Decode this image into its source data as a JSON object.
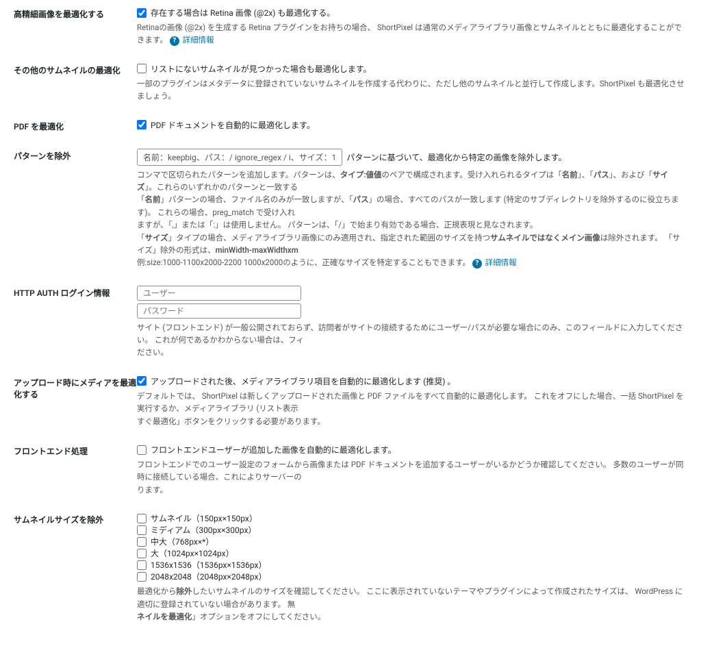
{
  "retina": {
    "label": "高精細画像を最適化する",
    "checkbox": "存在する場合は Retina 画像 (@2x) も最適化する。",
    "desc": "Retinaの画像 (@2x) を生成する Retina プラグインをお持ちの場合、 ShortPixel は通常のメディアライブラリ画像とサムネイルとともに最適化することができます。",
    "link": "詳細情報"
  },
  "other_thumbs": {
    "label": "その他のサムネイルの最適化",
    "checkbox": "リストにないサムネイルが見つかった場合も最適化します。",
    "desc": "一部のプラグインはメタデータに登録されていないサムネイルを作成する代わりに、ただし他のサムネイルと並行して作成します。ShortPixel も最適化させましょう。"
  },
  "pdf": {
    "label": "PDF を最適化",
    "checkbox": "PDF ドキュメントを自動的に最適化します。"
  },
  "exclude": {
    "label": "パターンを除外",
    "placeholder": "名前：keepbig、パス：/ ignore_regex / i、サイズ：1",
    "inline_desc": "パターンに基づいて、最適化から特定の画像を除外します。",
    "desc1a": "コンマで区切られたパターンを追加します。パターンは、",
    "desc1b": "タイプ:値値",
    "desc1c": "のペアで構成されます。受け入れられるタイプは「",
    "desc1d": "名前",
    "desc1e": "」、「",
    "desc1f": "パス",
    "desc1g": "」、および「",
    "desc1h": "サイズ",
    "desc1i": "」。これらのいずれかのパターンと一致する",
    "desc2a": "「",
    "desc2b": "名前",
    "desc2c": "」パターンの場合、ファイル名のみが一致しますが、「",
    "desc2d": "パス",
    "desc2e": "」の場合、すべてのパスが一致します (特定のサブディレクトリを除外するのに役立ちます)。 これらの場合、preg_match で受け入れ",
    "desc3": "ますが、「,」または「:」は使用しません。 パターンは、「/」で始まり有効である場合、正規表現と見なされます。",
    "desc4a": "「",
    "desc4b": "サイズ",
    "desc4c": "」タイプの場合、メディアライブラリ画像にのみ適用され、指定された範囲のサイズを持つ",
    "desc4d": "サムネイルではなくメイン画像",
    "desc4e": "は除外されます。 「サイズ」除外の形式は、",
    "desc4f": "minWidth-maxWidthxm",
    "desc5": "例:size:1000-1100x2000-2200 1000x2000のように、正確なサイズを特定することもできます。",
    "link": "詳細情報"
  },
  "http_auth": {
    "label": "HTTP AUTH ログイン情報",
    "user_placeholder": "ユーザー",
    "pass_placeholder": "パスワード",
    "desc": "サイト (フロントエンド) が一般公開されておらず、訪問者がサイトの接続するためにユーザー/パスが必要な場合にのみ、このフィールドに入力してください。 これが何であるかわからない場合は、フィ",
    "desc2": "ださい。"
  },
  "upload_opt": {
    "label": "アップロード時にメディアを最適化する",
    "checkbox": "アップロードされた後、メディアライブラリ項目を自動的に最適化します (推奨) 。",
    "desc": "デフォルトでは、 ShortPixel は新しくアップロードされた画像と PDF ファイルをすべて自動的に最適化します。 これをオフにした場合、一括 ShortPixel を実行するか、メディアライブラリ (リスト表示",
    "desc2": "すぐ最適化」ボタンをクリックする必要があります。"
  },
  "frontend": {
    "label": "フロントエンド処理",
    "checkbox": "フロントエンドユーザーが追加した画像を自動的に最適化します。",
    "desc": "フロントエンドでのユーザー設定のフォームから画像または PDF ドキュメントを追加するユーザーがいるかどうか確認してください。 多数のユーザーが同時に接続している場合、これによりサーバーの",
    "desc2": "ります。"
  },
  "thumb_sizes": {
    "label": "サムネイルサイズを除外",
    "sizes": [
      "サムネイル（150px×150px）",
      "ミディアム（300px×300px）",
      "中大（768px×*）",
      "大（1024px×1024px）",
      "1536x1536（1536px×1536px）",
      "2048x2048（2048px×2048px）"
    ],
    "desc1a": "最適化から",
    "desc1b": "除外",
    "desc1c": "したいサムネイルのサイズを確認してください。 ここに表示されていないテーマやプラグインによって作成されたサイズは、 WordPress に適切に登録されていない場合があります。 無",
    "desc2a": "ネイルを最適化",
    "desc2b": "」オプションをオフにしてください。"
  }
}
